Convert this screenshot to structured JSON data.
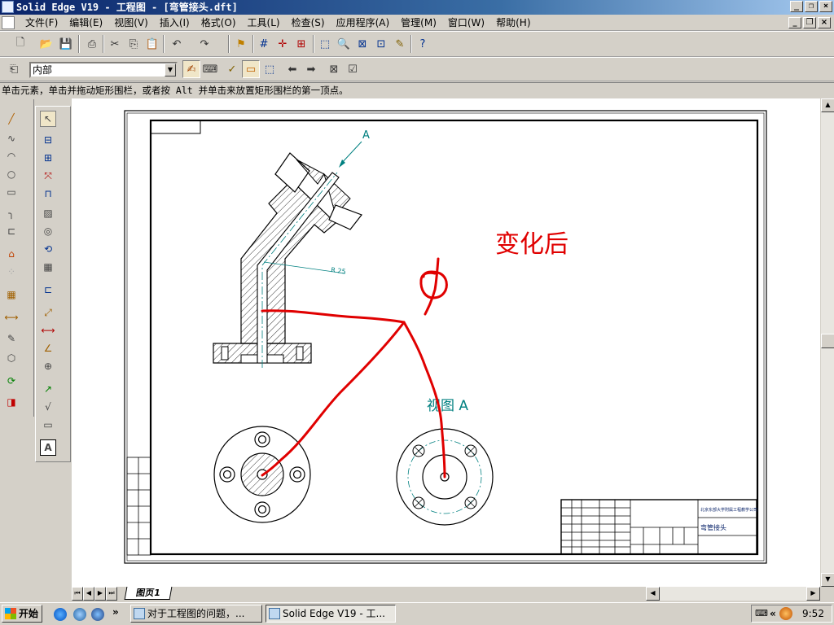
{
  "window": {
    "title": "Solid Edge V19 - 工程图 - [弯管接头.dft]"
  },
  "menu": [
    "文件(F)",
    "编辑(E)",
    "视图(V)",
    "插入(I)",
    "格式(O)",
    "工具(L)",
    "检查(S)",
    "应用程序(A)",
    "管理(M)",
    "窗口(W)",
    "帮助(H)"
  ],
  "layer_combo": {
    "value": "内部"
  },
  "prompt": "单击元素，单击并拖动矩形围栏，或者按 Alt 并单击来放置矩形围栏的第一顶点。",
  "drawing": {
    "annotation_changed": "变化后",
    "view_label": "视图 A",
    "section_mark": "A",
    "radius_dim": "R 25",
    "title_block": {
      "company": "北京东部大学附属工程教学公司",
      "part_name": "弯管接头"
    }
  },
  "sheet_tab": "图页1",
  "taskbar": {
    "start": "开始",
    "items": [
      "对于工程图的问题，...",
      "Solid Edge V19 - 工..."
    ],
    "chevron": "»",
    "clock": "9:52"
  },
  "colors": {
    "markup_red": "#e00000",
    "dim_teal": "#008080",
    "title_blue": "#0a246a"
  }
}
